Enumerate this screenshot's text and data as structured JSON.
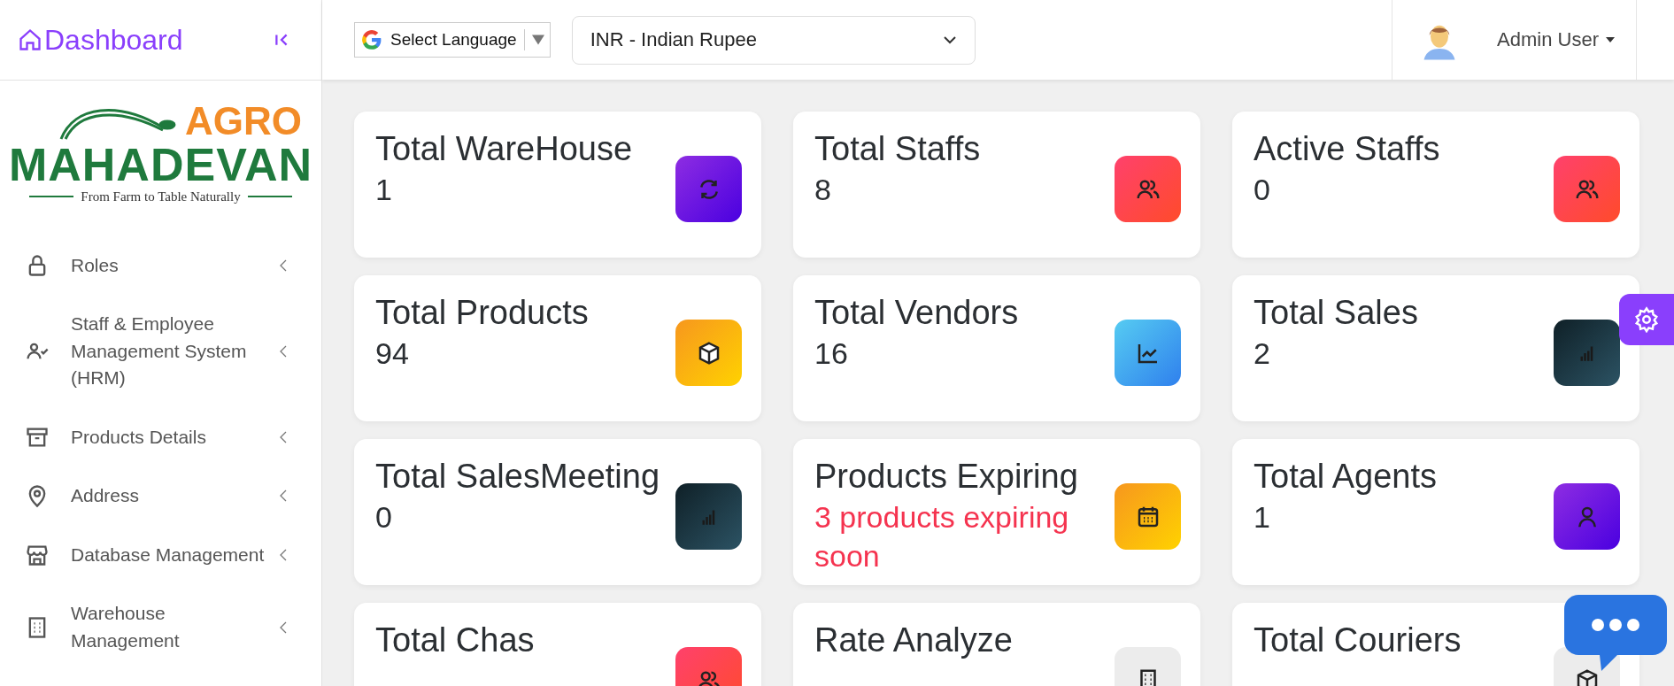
{
  "sidebar": {
    "title": "Dashboard",
    "logo": {
      "brand_top": "AGRO",
      "brand_main": "MAHADEVAN",
      "tagline": "From Farm to Table Naturally"
    },
    "menu": [
      {
        "label": "Roles",
        "kind": "lock"
      },
      {
        "label": "Staff & Employee Management System (HRM)",
        "kind": "user-check"
      },
      {
        "label": "Products Details",
        "kind": "archive"
      },
      {
        "label": "Address",
        "kind": "pin"
      },
      {
        "label": "Database Management",
        "kind": "store"
      },
      {
        "label": "Warehouse Management",
        "kind": "building"
      }
    ]
  },
  "header": {
    "language_select": "Select Language",
    "currency_select": "INR - Indian Rupee",
    "user": "Admin User"
  },
  "cards": [
    {
      "title": "Total WareHouse",
      "value": "1",
      "kind": "refresh",
      "alert": false
    },
    {
      "title": "Total Staffs",
      "value": "8",
      "kind": "users",
      "alert": false
    },
    {
      "title": "Active Staffs",
      "value": "0",
      "kind": "users",
      "alert": false
    },
    {
      "title": "Total Products",
      "value": "94",
      "kind": "box",
      "alert": false
    },
    {
      "title": "Total Vendors",
      "value": "16",
      "kind": "chart",
      "alert": false
    },
    {
      "title": "Total Sales",
      "value": "2",
      "kind": "bars",
      "alert": false
    },
    {
      "title": "Total SalesMeeting",
      "value": "0",
      "kind": "bars",
      "alert": false
    },
    {
      "title": "Products Expiring",
      "value": "3 products expiring soon",
      "kind": "calendar",
      "alert": true
    },
    {
      "title": "Total Agents",
      "value": "1",
      "kind": "user",
      "alert": false
    },
    {
      "title": "Total Chas",
      "kind": "users"
    },
    {
      "title": "Rate Analyze",
      "kind": "building"
    },
    {
      "title": "Total Couriers",
      "kind": "cube"
    }
  ]
}
